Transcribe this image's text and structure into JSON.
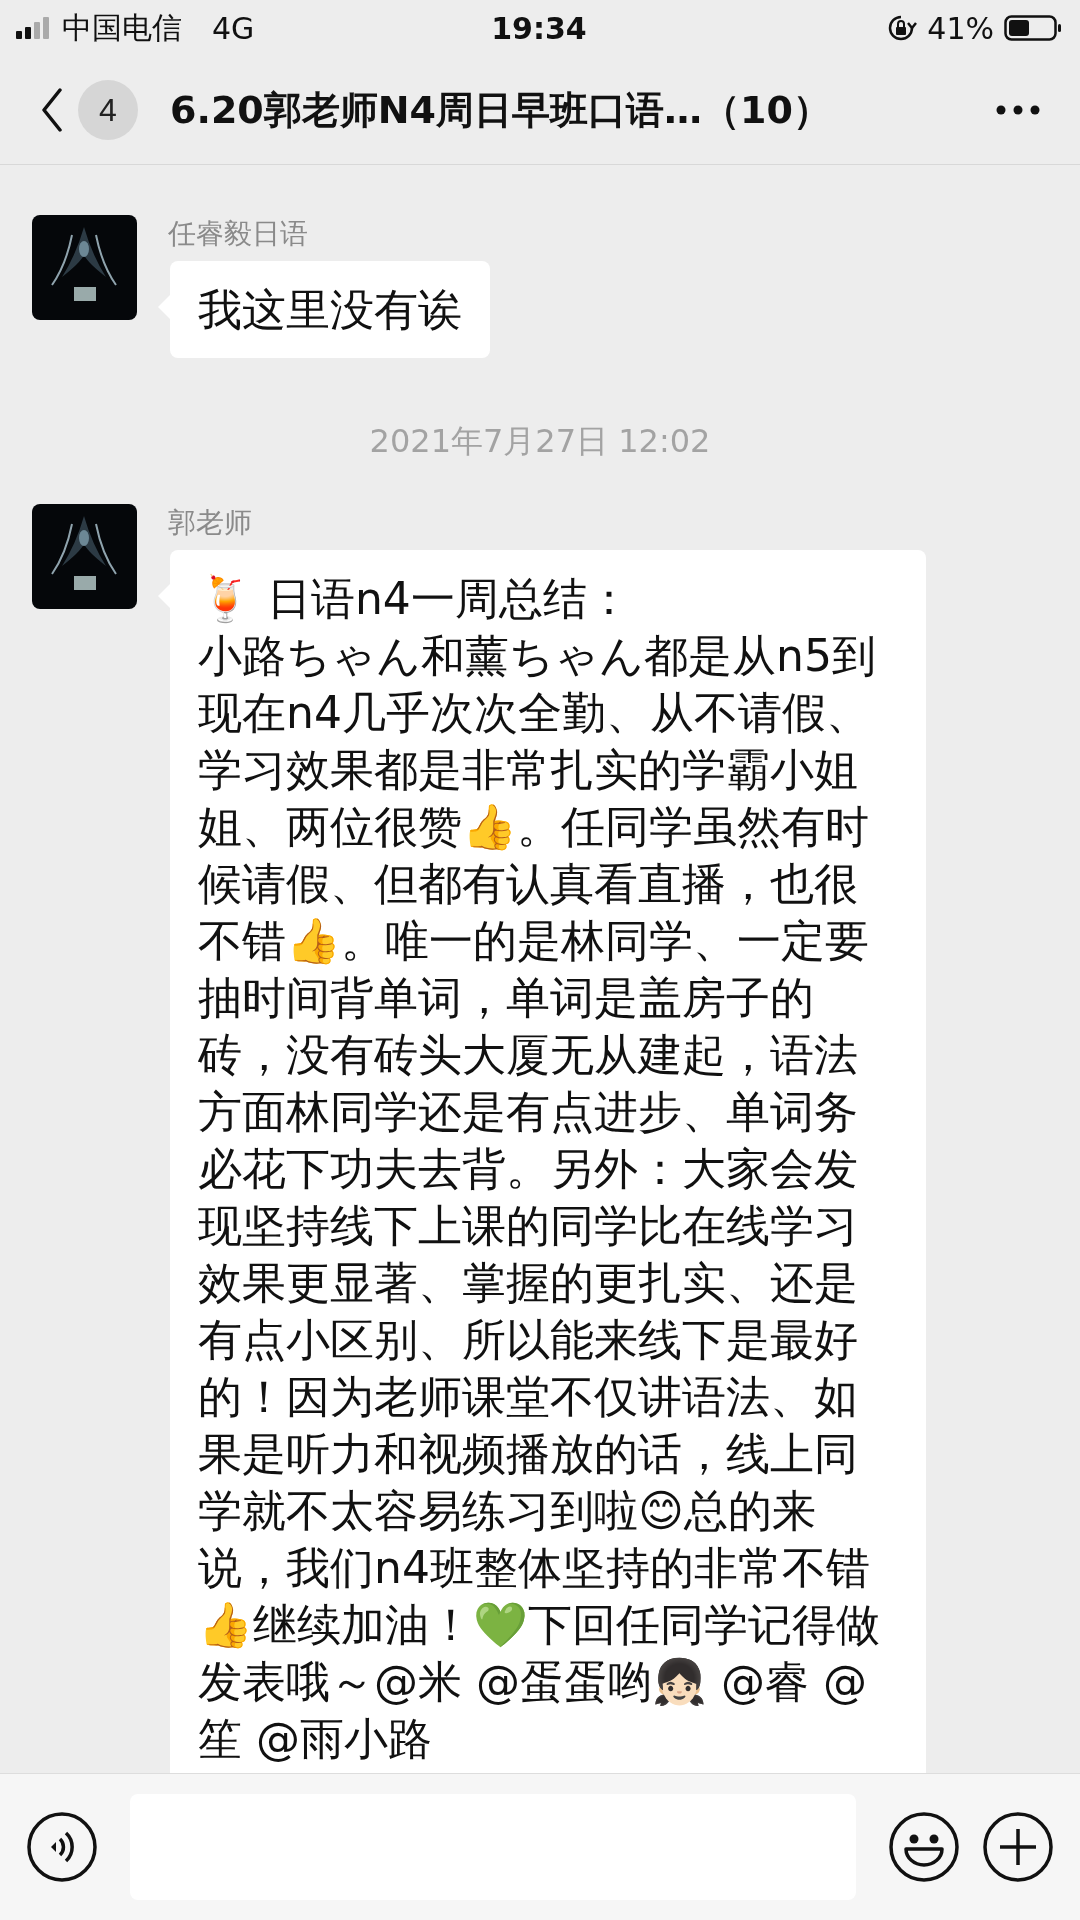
{
  "status_bar": {
    "carrier": "中国电信",
    "network": "4G",
    "time": "19:34",
    "battery": "41%"
  },
  "header": {
    "unread_count": "4",
    "title": "6.20郭老师N4周日早班口语…",
    "member_count": "（10）"
  },
  "messages": [
    {
      "kind": "text",
      "sender": "任睿毅日语",
      "paragraphs": [
        "我这里没有诶"
      ]
    },
    {
      "kind": "timestamp",
      "text": "2021年7月27日 12:02"
    },
    {
      "kind": "text",
      "sender": "郭老师",
      "paragraphs": [
        "🍹 日语n4一周总结：",
        "小路ちゃん和薰ちゃん都是从n5到现在n4几乎次次全勤、从不请假、学习效果都是非常扎实的学霸小姐姐、两位很赞👍。任同学虽然有时候请假、但都有认真看直播，也很不错👍。唯一的是林同学、一定要抽时间背单词，单词是盖房子的砖，没有砖头大厦无从建起，语法方面林同学还是有点进步、单词务必花下功夫去背。另外：大家会发现坚持线下上课的同学比在线学习效果更显著、掌握的更扎实、还是有点小区别、所以能来线下是最好的！因为老师课堂不仅讲语法、如果是听力和视频播放的话，线上同学就不太容易练习到啦😊总的来说，我们n4班整体坚持的非常不错👍继续加油！💚下回任同学记得做发表哦～@米 @蛋蛋哟👧🏻 @睿 @笙 @雨小路"
      ]
    }
  ]
}
